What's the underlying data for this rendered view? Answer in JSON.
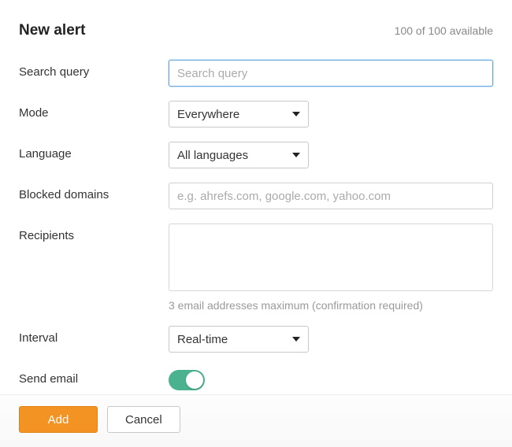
{
  "header": {
    "title": "New alert",
    "availability": "100 of 100 available"
  },
  "fields": {
    "search_query": {
      "label": "Search query",
      "placeholder": "Search query",
      "value": ""
    },
    "mode": {
      "label": "Mode",
      "selected": "Everywhere"
    },
    "language": {
      "label": "Language",
      "selected": "All languages"
    },
    "blocked_domains": {
      "label": "Blocked domains",
      "placeholder": "e.g. ahrefs.com, google.com, yahoo.com",
      "value": ""
    },
    "recipients": {
      "label": "Recipients",
      "value": "",
      "help": "3 email addresses maximum (confirmation required)"
    },
    "interval": {
      "label": "Interval",
      "selected": "Real-time"
    },
    "send_email": {
      "label": "Send email",
      "on": true
    }
  },
  "footer": {
    "add_label": "Add",
    "cancel_label": "Cancel"
  },
  "colors": {
    "accent": "#f39324",
    "toggle_on": "#4bb28f"
  }
}
